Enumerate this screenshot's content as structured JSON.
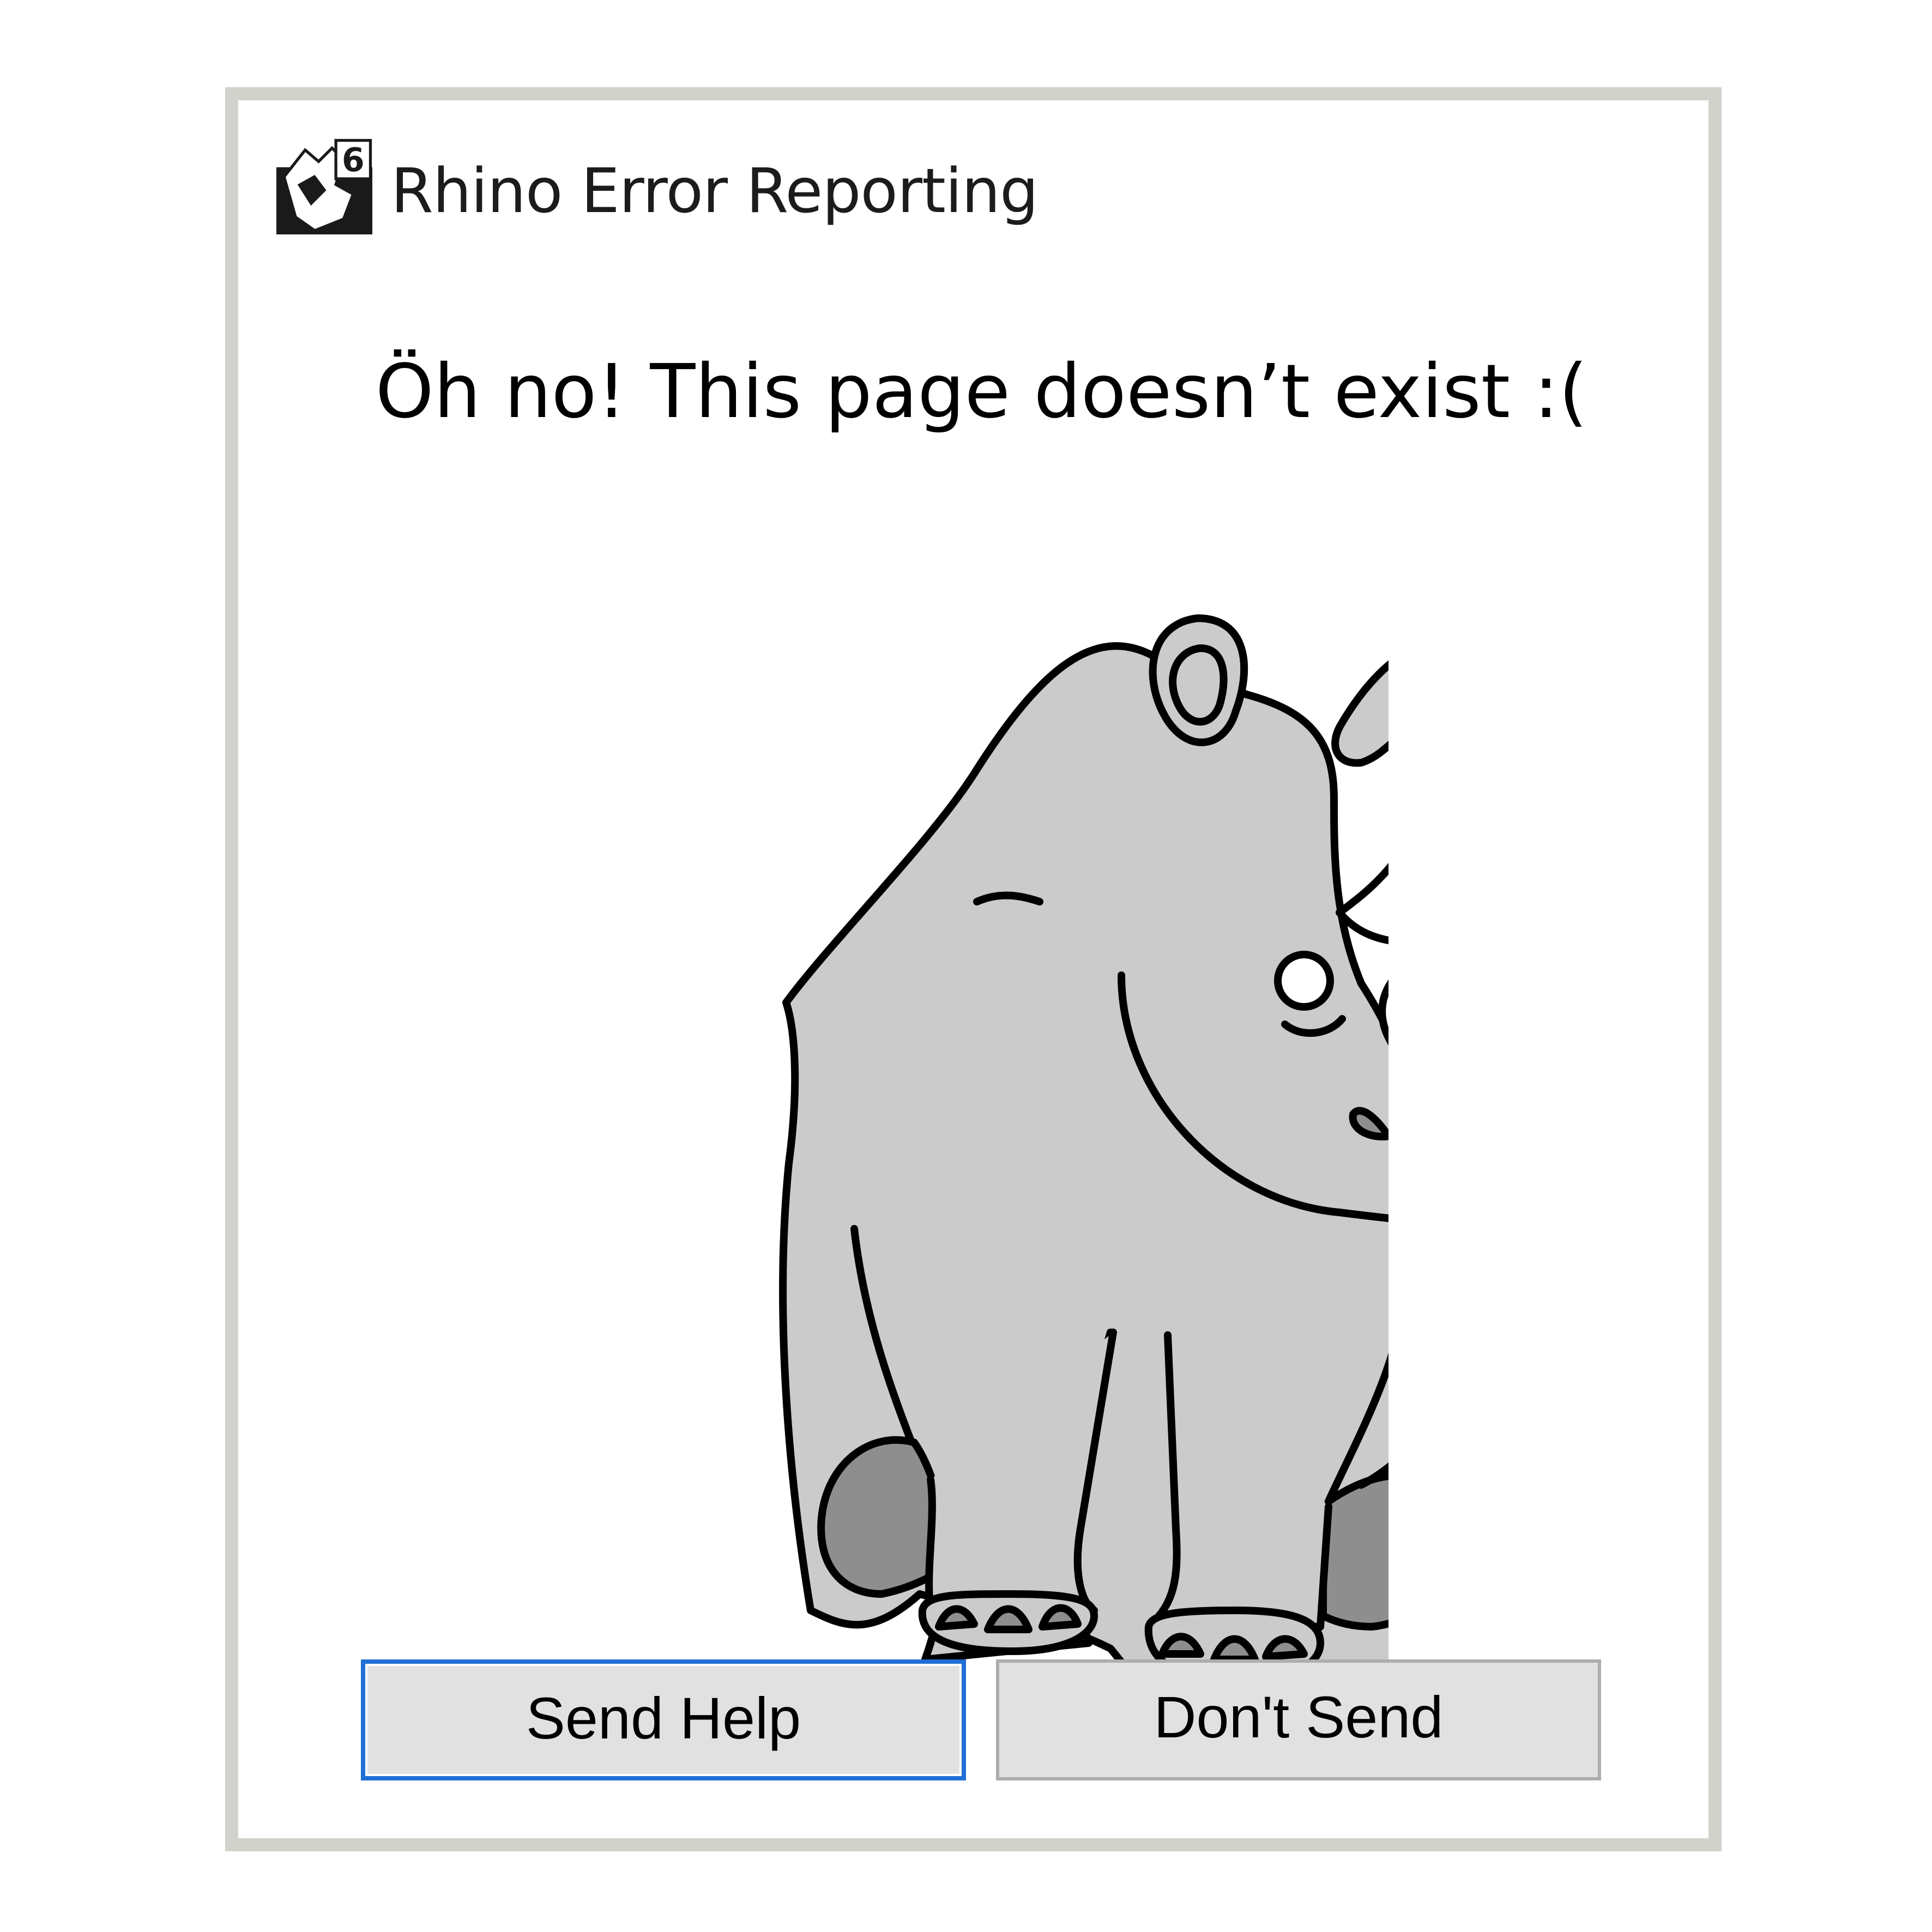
{
  "dialog": {
    "title": "Rhino Error Reporting",
    "app_icon": "rhino-6-icon",
    "message": "Öh no! This page doesn’t exist :(",
    "illustration": "sad-rhino-illustration",
    "buttons": {
      "send_help_label": "Send Help",
      "dont_send_label": "Don't Send"
    }
  },
  "colors": {
    "border": "#d2d2cc",
    "rhino_body": "#cbcbcb",
    "rhino_feet": "#8e8e8e",
    "outline": "#000000",
    "button_bg": "#e1e1e1",
    "focus_border": "#1f6fd6"
  }
}
